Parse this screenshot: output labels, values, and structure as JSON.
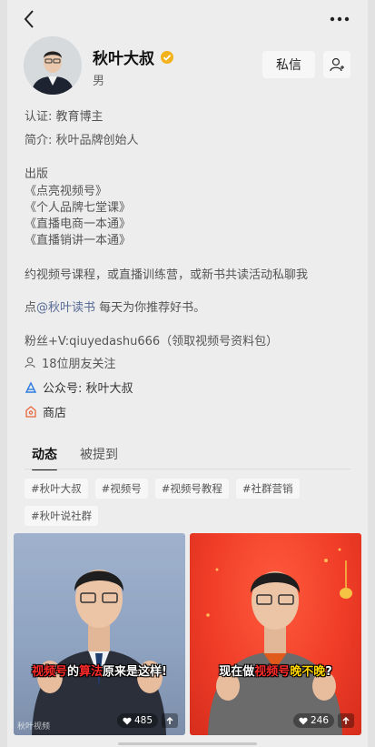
{
  "profile": {
    "name": "秋叶大叔",
    "gender": "男",
    "message_button": "私信"
  },
  "info": {
    "certification": "认证: 教育博主",
    "intro": "简介: 秋叶品牌创始人",
    "publish_heading": "出版",
    "books": [
      "《点亮视频号》",
      "《个人品牌七堂课》",
      "《直播电商一本通》",
      "《直播销讲一本通》"
    ],
    "invite": "约视频号课程，或直播训练营，或新书共读活动私聊我",
    "recommend_prefix": "点",
    "recommend_link": "@秋叶读书",
    "recommend_suffix": " 每天为你推荐好书。",
    "fans_contact": "粉丝+V:qiuyedashu666（领取视频号资料包）",
    "friends_following": "18位朋友关注",
    "official_account": "公众号: 秋叶大叔",
    "shop": "商店"
  },
  "tabs": [
    "动态",
    "被提到"
  ],
  "tags": [
    "#秋叶大叔",
    "#视频号",
    "#视频号教程",
    "#社群营销",
    "#秋叶说社群"
  ],
  "videos": [
    {
      "caption_parts": [
        {
          "text": "视频号",
          "style": "hl"
        },
        {
          "text": "的",
          "style": "plain"
        },
        {
          "text": "算法",
          "style": "hl"
        },
        {
          "text": "原来是这样!",
          "style": "plain"
        }
      ],
      "likes": "485",
      "watermark": "秋叶视频"
    },
    {
      "caption_parts": [
        {
          "text": "现在做",
          "style": "plain"
        },
        {
          "text": "视频号",
          "style": "hl"
        },
        {
          "text": "晚不晚",
          "style": "hl2"
        },
        {
          "text": "?",
          "style": "plain"
        }
      ],
      "likes": "246"
    }
  ],
  "colors": {
    "background": "#ededed",
    "link": "#576b95",
    "verified_badge": "#f2b21b",
    "shop_icon": "#e8663a",
    "official_icon": "#2f7de1"
  }
}
